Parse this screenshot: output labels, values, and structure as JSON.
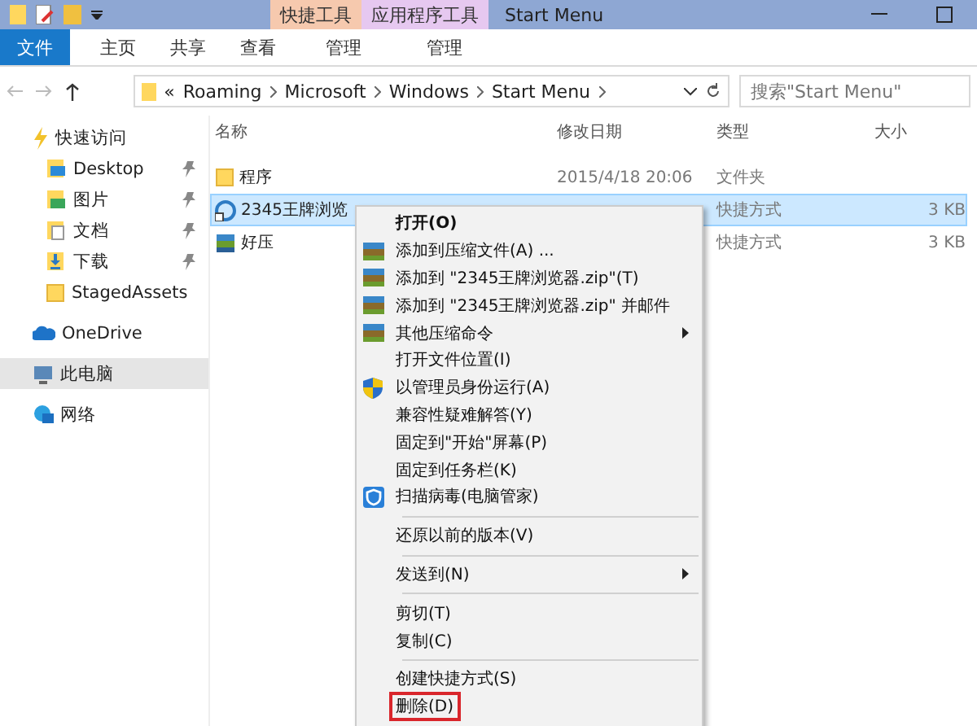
{
  "title_bar": {
    "context_tabs": [
      {
        "label": "快捷工具",
        "kind": "shortcut"
      },
      {
        "label": "应用程序工具",
        "kind": "app"
      }
    ],
    "title": "Start Menu"
  },
  "ribbon_tabs": [
    {
      "label": "文件",
      "selected": true
    },
    {
      "label": "主页",
      "selected": false
    },
    {
      "label": "共享",
      "selected": false
    },
    {
      "label": "查看",
      "selected": false
    },
    {
      "label": "管理",
      "selected": false
    },
    {
      "label": "管理",
      "selected": false
    }
  ],
  "address": {
    "crumbs": [
      "«",
      "Roaming",
      "Microsoft",
      "Windows",
      "Start Menu"
    ],
    "search_placeholder": "搜索\"Start Menu\""
  },
  "sidebar": [
    {
      "label": "快速访问",
      "kind": "star",
      "pinned": false,
      "selected": false,
      "children": [
        {
          "label": "Desktop",
          "kind": "desktop",
          "pinned": true,
          "selected": false
        },
        {
          "label": "图片",
          "kind": "pictures",
          "pinned": true,
          "selected": false
        },
        {
          "label": "文档",
          "kind": "documents",
          "pinned": true,
          "selected": false
        },
        {
          "label": "下载",
          "kind": "downloads",
          "pinned": true,
          "selected": false
        },
        {
          "label": "StagedAssets",
          "kind": "folder",
          "pinned": false,
          "selected": false
        }
      ]
    },
    {
      "label": "OneDrive",
      "kind": "cloud",
      "pinned": false,
      "selected": false
    },
    {
      "label": "此电脑",
      "kind": "pc",
      "pinned": false,
      "selected": true
    },
    {
      "label": "网络",
      "kind": "network",
      "pinned": false,
      "selected": false
    }
  ],
  "columns": [
    "名称",
    "修改日期",
    "类型",
    "大小"
  ],
  "files": [
    {
      "name": "程序",
      "date": "2015/4/18 20:06",
      "type": "文件夹",
      "kind": "folder",
      "selected": false
    },
    {
      "name": "2345王牌浏览",
      "type": "快捷方式",
      "size": "3 KB",
      "kind": "browser",
      "selected": true
    },
    {
      "name": "好压",
      "type": "快捷方式",
      "size": "3 KB",
      "kind": "archive",
      "selected": false
    }
  ],
  "context_menu": {
    "groups": [
      [
        {
          "label": "打开(O)",
          "kind": "plain",
          "default": true,
          "submenu": false,
          "boxed": false
        },
        {
          "label": "添加到压缩文件(A) ...",
          "kind": "archive",
          "default": false,
          "submenu": false,
          "boxed": false
        },
        {
          "label": "添加到 \"2345王牌浏览器.zip\"(T)",
          "kind": "archive",
          "default": false,
          "submenu": false,
          "boxed": false
        },
        {
          "label": "添加到 \"2345王牌浏览器.zip\" 并邮件",
          "kind": "archive",
          "default": false,
          "submenu": false,
          "boxed": false
        },
        {
          "label": "其他压缩命令",
          "kind": "archive",
          "default": false,
          "submenu": true,
          "boxed": false
        },
        {
          "label": "打开文件位置(I)",
          "kind": "plain",
          "default": false,
          "submenu": false,
          "boxed": false
        },
        {
          "label": "以管理员身份运行(A)",
          "kind": "shield",
          "default": false,
          "submenu": false,
          "boxed": false
        },
        {
          "label": "兼容性疑难解答(Y)",
          "kind": "plain",
          "default": false,
          "submenu": false,
          "boxed": false
        },
        {
          "label": "固定到\"开始\"屏幕(P)",
          "kind": "plain",
          "default": false,
          "submenu": false,
          "boxed": false
        },
        {
          "label": "固定到任务栏(K)",
          "kind": "plain",
          "default": false,
          "submenu": false,
          "boxed": false
        },
        {
          "label": "扫描病毒(电脑管家)",
          "kind": "guard",
          "default": false,
          "submenu": false,
          "boxed": false
        }
      ],
      [
        {
          "label": "还原以前的版本(V)",
          "kind": "plain",
          "default": false,
          "submenu": false,
          "boxed": false
        }
      ],
      [
        {
          "label": "发送到(N)",
          "kind": "plain",
          "default": false,
          "submenu": true,
          "boxed": false
        }
      ],
      [
        {
          "label": "剪切(T)",
          "kind": "plain",
          "default": false,
          "submenu": false,
          "boxed": false
        },
        {
          "label": "复制(C)",
          "kind": "plain",
          "default": false,
          "submenu": false,
          "boxed": false
        }
      ],
      [
        {
          "label": "创建快捷方式(S)",
          "kind": "plain",
          "default": false,
          "submenu": false,
          "boxed": false
        },
        {
          "label": "删除(D)",
          "kind": "plain",
          "default": false,
          "submenu": false,
          "boxed": true
        }
      ]
    ]
  }
}
